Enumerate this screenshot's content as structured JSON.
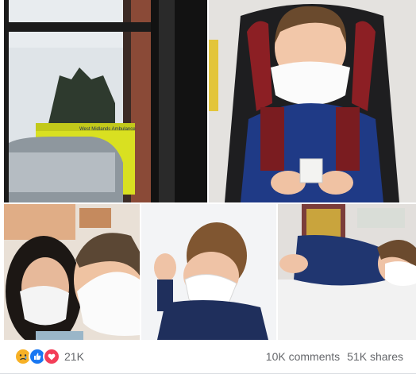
{
  "post": {
    "photos": [
      {
        "alt": "Ambulance outside hospital window"
      },
      {
        "alt": "Boy in car seat wearing mask"
      },
      {
        "alt": "Woman and boy wearing masks"
      },
      {
        "alt": "Boy lying on hospital bed"
      },
      {
        "alt": "Boy sleeping on hospital bed"
      }
    ],
    "ambulance_text": "West Midlands Ambulance"
  },
  "reactions": {
    "icons": [
      "sad-icon",
      "like-icon",
      "love-icon"
    ],
    "count": "21K"
  },
  "stats": {
    "comments": "10K comments",
    "shares": "51K shares"
  },
  "colors": {
    "like": "#1877f2",
    "love": "#f33e58",
    "sad": "#f7b125",
    "meta_text": "#65676b"
  }
}
